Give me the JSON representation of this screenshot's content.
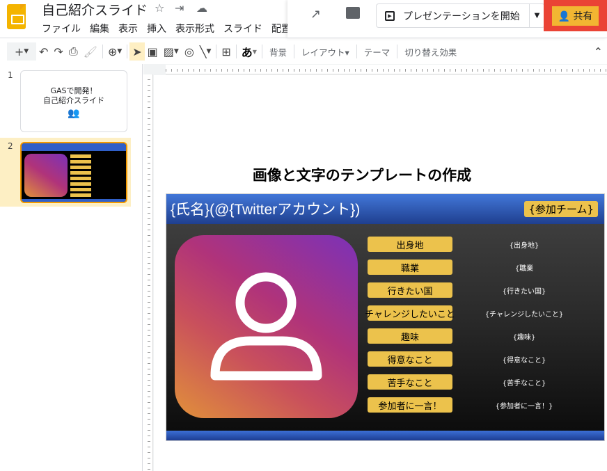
{
  "app": {
    "title": "自己紹介スライド",
    "menu": [
      "ファイル",
      "編集",
      "表示",
      "挿入",
      "表示形式",
      "スライド",
      "配置"
    ]
  },
  "header": {
    "present_label": "プレゼンテーションを開始",
    "share_label": "共有"
  },
  "toolbar": {
    "font_glyph": "あ",
    "background": "背景",
    "layout": "レイアウト",
    "theme": "テーマ",
    "transition": "切り替え効果"
  },
  "filmstrip": [
    {
      "number": "1",
      "title_line1": "GASで開発！",
      "title_line2": "自己紹介スライド"
    },
    {
      "number": "2",
      "selected": true
    }
  ],
  "slide": {
    "heading": "画像と文字のテンプレートの作成",
    "name": "{氏名}(@{Twitterアカウント})",
    "team": "{参加チーム}",
    "rows": [
      {
        "label": "出身地",
        "value": "{出身地}"
      },
      {
        "label": "職業",
        "value": "{職業"
      },
      {
        "label": "行きたい国",
        "value": "{行きたい国}"
      },
      {
        "label": "チャレンジしたいこと",
        "value": "{チャレンジしたいこと}"
      },
      {
        "label": "趣味",
        "value": "{趣味}"
      },
      {
        "label": "得意なこと",
        "value": "{得意なこと}"
      },
      {
        "label": "苦手なこと",
        "value": "{苦手なこと}"
      },
      {
        "label": "参加者に一言！",
        "value": "{参加者に一言！}"
      }
    ]
  }
}
